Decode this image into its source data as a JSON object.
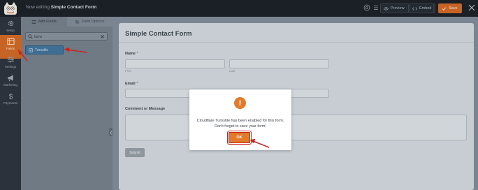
{
  "header": {
    "title_prefix": "Now editing",
    "form_name": "Simple Contact Form",
    "preview_label": "Preview",
    "embed_label": "Embed",
    "save_label": "Save"
  },
  "leftnav": {
    "items": [
      {
        "label": "Setup",
        "icon": "gear-icon"
      },
      {
        "label": "Fields",
        "icon": "fields-icon",
        "active": true
      },
      {
        "label": "Settings",
        "icon": "sliders-icon"
      },
      {
        "label": "Marketing",
        "icon": "megaphone-icon"
      },
      {
        "label": "Payments",
        "icon": "dollar-icon"
      }
    ]
  },
  "panel": {
    "tabs": [
      {
        "label": "Add Fields",
        "active": true
      },
      {
        "label": "Field Options",
        "active": false
      }
    ],
    "search_value": "turns",
    "result_field": "Turnstile"
  },
  "form": {
    "title": "Simple Contact Form",
    "name_label": "Name",
    "first_sublabel": "First",
    "last_sublabel": "Last",
    "email_label": "Email",
    "comment_label": "Comment or Message",
    "required_marker": "*",
    "submit_label": "Submit"
  },
  "modal": {
    "icon_glyph": "!",
    "message_line1": "Cloudflare Turnstile has been enabled for this form.",
    "message_line2": "Don't forget to save your form!",
    "ok_label": "OK"
  },
  "colors": {
    "accent": "#e07b2c",
    "active_nav": "#c56424",
    "field_button": "#3e6e94",
    "annotation": "#c8261e"
  }
}
